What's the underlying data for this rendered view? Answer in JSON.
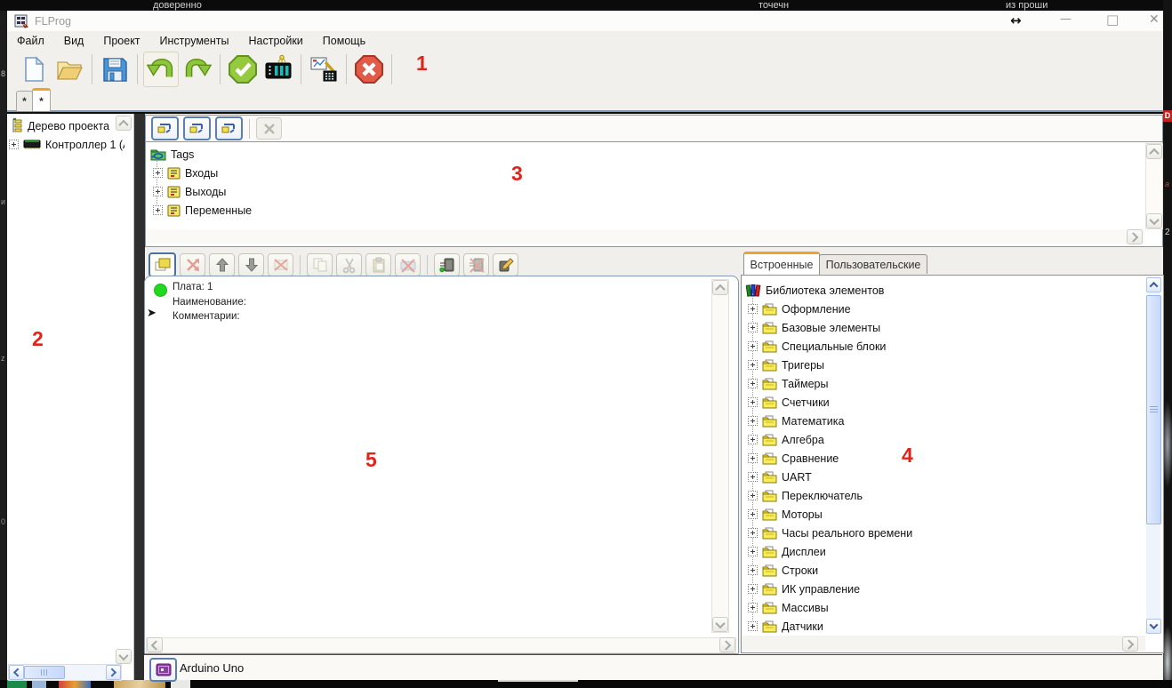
{
  "colors": {
    "accent_tab_orange": "#f0a22b",
    "annotation_red": "#e0241b",
    "panel_border_blue": "#7e99b0",
    "button_border_blue": "#5b7fb0",
    "toolbar_green": "#8cc63e",
    "abort_red": "#e25a48",
    "tag_yellow": "#f0e050",
    "scroll_blue_thumb": "#cfdffc"
  },
  "background": {
    "top_texts": [
      "доверенно",
      "точечн",
      "из проши"
    ],
    "left_edge_texts": [
      "8",
      "и",
      "z",
      "0"
    ],
    "right_edge_badge": "D",
    "right_edge_mark": "a",
    "right_edge_number": "2"
  },
  "titlebar": {
    "title": "FLProg",
    "controls": {
      "resize": "↔",
      "minimize": "—",
      "maximize": "□",
      "close": "✕"
    }
  },
  "menu": {
    "items": [
      "Файл",
      "Вид",
      "Проект",
      "Инструменты",
      "Настройки",
      "Помощь"
    ]
  },
  "main_toolbar": {
    "buttons": [
      "new-project",
      "open-project",
      "save-project",
      "undo",
      "redo",
      "compile-project",
      "upload-to-controller",
      "monitoring",
      "abort"
    ]
  },
  "tab_strip": {
    "tabs": [
      "*",
      "*"
    ],
    "active_index": 1
  },
  "project_tree": {
    "title": "Дерево проекта",
    "controller": "Контроллер 1 (A"
  },
  "tags_panel": {
    "toolbar": [
      "add-tag-1",
      "add-tag-2",
      "add-tag-3",
      "delete-tag"
    ],
    "root": "Tags",
    "items": [
      "Входы",
      "Выходы",
      "Переменные"
    ]
  },
  "board_panel": {
    "toolbar": [
      "add-board",
      "swap-boards",
      "move-up",
      "move-down",
      "remove-board",
      "copy",
      "cut",
      "paste",
      "remove-block",
      "insert-input",
      "insert-output",
      "edit-block"
    ],
    "board": "Плата: 1",
    "name": "Наименование:",
    "comments": "Комментарии:",
    "cursor_glyph": "➤"
  },
  "library": {
    "tabs": [
      "Встроенные",
      "Пользовательские"
    ],
    "active_tab": "Встроенные",
    "root": "Библиотека элементов",
    "folders": [
      "Оформление",
      "Базовые элементы",
      "Специальные блоки",
      "Тригеры",
      "Таймеры",
      "Счетчики",
      "Математика",
      "Алгебра",
      "Сравнение",
      "UART",
      "Переключатель",
      "Моторы",
      "Часы реального времени",
      "Дисплеи",
      "Строки",
      "ИК управление",
      "Массивы",
      "Датчики"
    ]
  },
  "status_bar": {
    "controller": "Arduino Uno"
  },
  "annotations": [
    "1",
    "2",
    "3",
    "4",
    "5"
  ]
}
